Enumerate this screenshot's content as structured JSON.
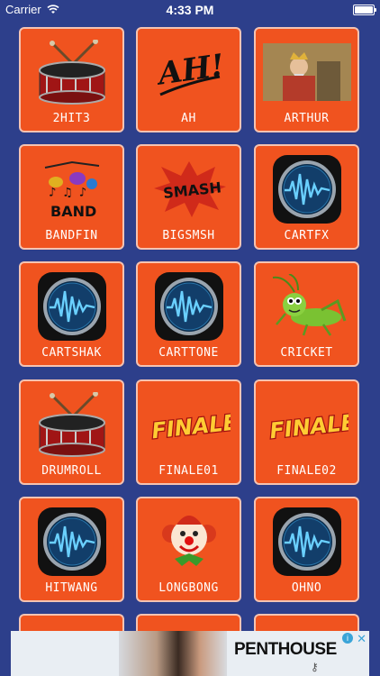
{
  "status": {
    "carrier": "Carrier",
    "time": "4:33 PM"
  },
  "colors": {
    "background": "#2d3f8b",
    "tile": "#f0531f",
    "tile_border": "#f4c3b2"
  },
  "tiles": [
    {
      "label": "2HIT3",
      "icon": "drum-icon"
    },
    {
      "label": "AH",
      "icon": "ah-text-icon"
    },
    {
      "label": "ARTHUR",
      "icon": "king-portrait-icon"
    },
    {
      "label": "BANDFIN",
      "icon": "band-instruments-icon"
    },
    {
      "label": "BIGSMSH",
      "icon": "smash-burst-icon"
    },
    {
      "label": "CARTFX",
      "icon": "sound-wave-icon"
    },
    {
      "label": "CARTSHAK",
      "icon": "sound-wave-icon"
    },
    {
      "label": "CARTTONE",
      "icon": "sound-wave-icon"
    },
    {
      "label": "CRICKET",
      "icon": "cricket-icon"
    },
    {
      "label": "DRUMROLL",
      "icon": "drum-icon"
    },
    {
      "label": "FINALE01",
      "icon": "finale-text-icon"
    },
    {
      "label": "FINALE02",
      "icon": "finale-text-icon"
    },
    {
      "label": "HITWANG",
      "icon": "sound-wave-icon"
    },
    {
      "label": "LONGBONG",
      "icon": "clown-icon"
    },
    {
      "label": "OHNO",
      "icon": "sound-wave-icon"
    }
  ],
  "ad": {
    "brand": "PENTHOUSE",
    "key_glyph": "⚷",
    "info": "i",
    "close": "✕"
  }
}
